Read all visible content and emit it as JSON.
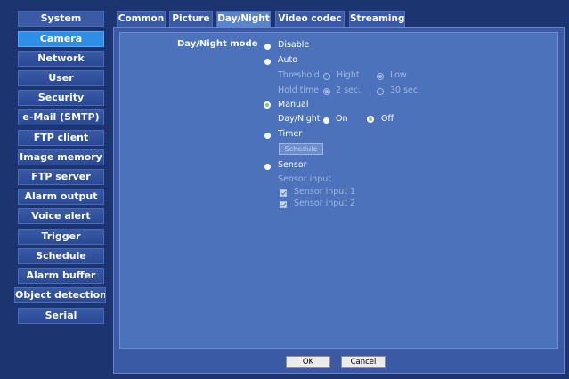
{
  "sidebar": {
    "items": [
      {
        "label": "System"
      },
      {
        "label": "Camera"
      },
      {
        "label": "Network"
      },
      {
        "label": "User"
      },
      {
        "label": "Security"
      },
      {
        "label": "e-Mail (SMTP)"
      },
      {
        "label": "FTP client"
      },
      {
        "label": "Image memory"
      },
      {
        "label": "FTP server"
      },
      {
        "label": "Alarm output"
      },
      {
        "label": "Voice alert"
      },
      {
        "label": "Trigger"
      },
      {
        "label": "Schedule"
      },
      {
        "label": "Alarm buffer"
      },
      {
        "label": "Object detection"
      },
      {
        "label": "Serial"
      }
    ],
    "active": "Camera"
  },
  "tabs": [
    {
      "label": "Common"
    },
    {
      "label": "Picture"
    },
    {
      "label": "Day/Night"
    },
    {
      "label": "Video codec"
    },
    {
      "label": "Streaming"
    }
  ],
  "active_tab": "Day/Night",
  "form": {
    "mode_label": "Day/Night mode",
    "disable": "Disable",
    "auto": "Auto",
    "threshold_label": "Threshold",
    "threshold_high": "Hight",
    "threshold_low": "Low",
    "hold_time_label": "Hold time",
    "hold_2sec": "2 sec.",
    "hold_30sec": "30 sec.",
    "manual": "Manual",
    "daynight_label": "Day/Night",
    "on": "On",
    "off": "Off",
    "timer": "Timer",
    "schedule_button": "Schedule",
    "sensor": "Sensor",
    "sensor_input_label": "Sensor input",
    "sensor_input_1": "Sensor input 1",
    "sensor_input_2": "Sensor input 2",
    "selected_mode": "Manual",
    "selected_daynight": "Off"
  },
  "actions": {
    "ok": "OK",
    "cancel": "Cancel"
  },
  "colors": {
    "background": "#1c3470",
    "panel": "#4c72bc",
    "active_item": "#2f8fe6"
  }
}
